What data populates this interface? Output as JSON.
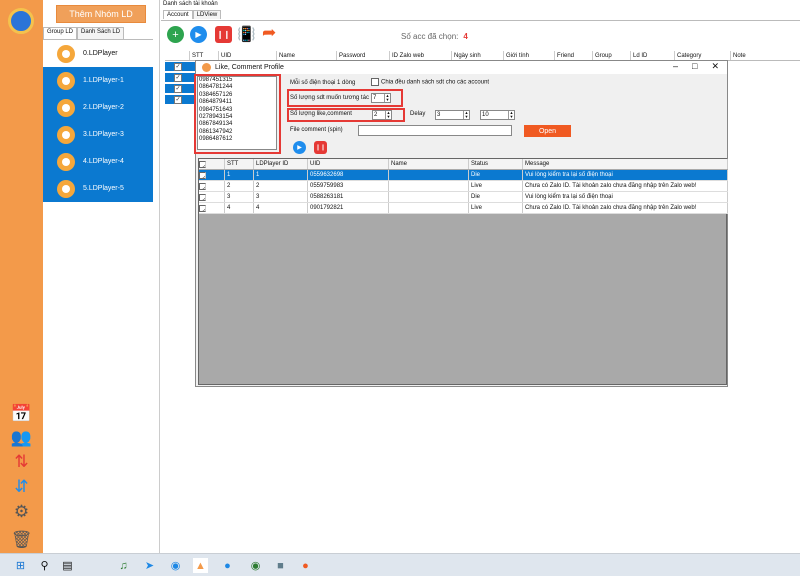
{
  "sidebar": {
    "add_group_label": "Thêm Nhóm LD",
    "tabs": [
      "Group LD",
      "Danh Sách LD"
    ],
    "players": [
      {
        "label": "0.LDPlayer",
        "selected": false
      },
      {
        "label": "1.LDPlayer-1",
        "selected": true
      },
      {
        "label": "2.LDPlayer-2",
        "selected": true
      },
      {
        "label": "3.LDPlayer-3",
        "selected": true
      },
      {
        "label": "4.LDPlayer-4",
        "selected": true
      },
      {
        "label": "5.LDPlayer-5",
        "selected": true
      }
    ],
    "icons": [
      "logo-icon",
      "calendar-icon",
      "users-icon",
      "sync-icon",
      "sort-icon",
      "gear-icon",
      "trash-icon"
    ]
  },
  "main": {
    "title": "Danh sách tài khoản",
    "tabs": [
      "Account",
      "LDView"
    ],
    "selected_count_label": "Số acc đã chọn:",
    "selected_count": "4",
    "columns": [
      "STT",
      "UID",
      "Name",
      "Password",
      "ID Zalo web",
      "Ngày sinh",
      "Giới tính",
      "Friend",
      "Group",
      "Ld ID",
      "Category",
      "Note"
    ]
  },
  "dialog": {
    "title": "Like, Comment Profile",
    "phones": [
      "0987451315",
      "0864781244",
      "0384657126",
      "0864879411",
      "0984751643",
      "0278943154",
      "0867849134",
      "0861347942",
      "0986487612"
    ],
    "one_per_line_label": "Mỗi số điện thoại 1 dòng",
    "split_label": "Chia đều danh sách sdt cho các account",
    "interact_count_label": "Số lượng sdt muốn tương tác",
    "interact_count": "7",
    "like_comment_label": "Số lượng like,comment",
    "like_comment_count": "2",
    "delay_label": "Delay",
    "delay_min": "3",
    "delay_max": "10",
    "file_comment_label": "File comment (spin)",
    "open_label": "Open",
    "grid_columns": [
      "STT",
      "LDPlayer ID",
      "UID",
      "Name",
      "Status",
      "Message"
    ],
    "grid_rows": [
      {
        "stt": "1",
        "ld": "1",
        "uid": "0559632698",
        "name": "",
        "status": "Die",
        "message": "Vui lòng kiểm tra lại số điện thoại"
      },
      {
        "stt": "2",
        "ld": "2",
        "uid": "0559759983",
        "name": "",
        "status": "Live",
        "message": "Chưa có Zalo ID. Tài khoản zalo chưa đăng nhập trên Zalo web!"
      },
      {
        "stt": "3",
        "ld": "3",
        "uid": "0588263181",
        "name": "",
        "status": "Die",
        "message": "Vui lòng kiểm tra lại số điện thoại"
      },
      {
        "stt": "4",
        "ld": "4",
        "uid": "0901792821",
        "name": "",
        "status": "Live",
        "message": "Chưa có Zalo ID. Tài khoản zalo chưa đăng nhập trên Zalo web!"
      }
    ]
  },
  "taskbar": {
    "apps": [
      "windows-start",
      "search",
      "task-view",
      "music-app",
      "telegram",
      "chrome-app",
      "zalo-tool",
      "zalo",
      "multi-app",
      "tool-app",
      "ldplayer-app"
    ]
  }
}
